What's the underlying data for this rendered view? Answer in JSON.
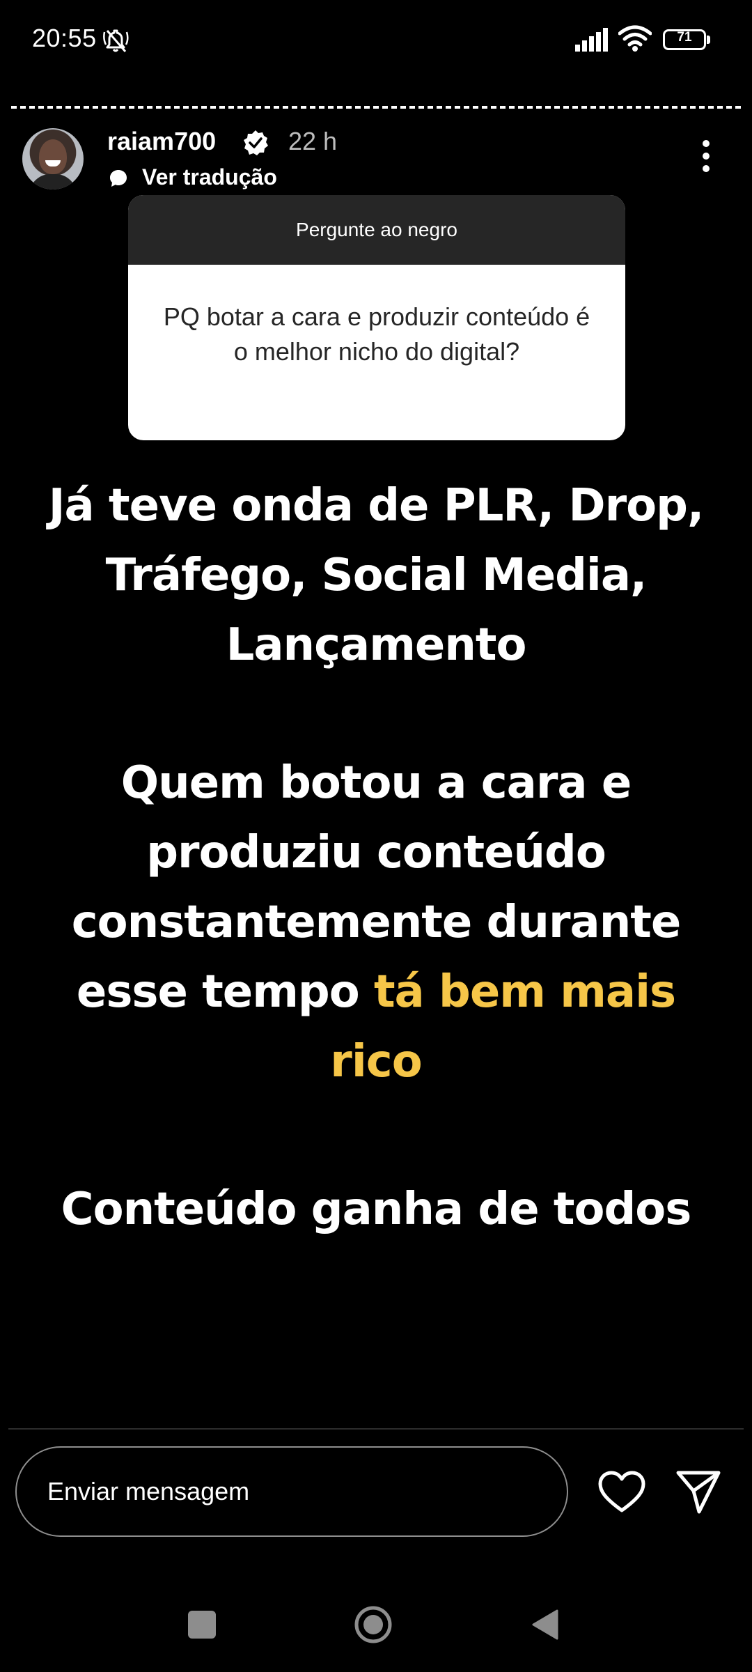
{
  "status_bar": {
    "time": "20:55",
    "battery_level": "71",
    "icons": [
      "mute-icon",
      "signal-icon",
      "wifi-icon",
      "battery-icon"
    ]
  },
  "story": {
    "progress": 1,
    "username": "raiam700",
    "verified": true,
    "time_ago": "22 h",
    "translate_label": "Ver tradução",
    "question_sticker": {
      "header": "Pergunte ao negro",
      "question": "PQ botar a cara e produzir conteúdo é o melhor nicho do digital?"
    },
    "text_block_1": "Já teve onda de PLR, Drop, Tráfego, Social Media, Lançamento",
    "text_block_2_main": "Quem botou a cara e produziu conteúdo constantemente durante esse tempo ",
    "text_block_2_highlight": "tá bem mais rico",
    "text_block_3": "Conteúdo ganha de todos",
    "highlight_color": "#f6c648"
  },
  "footer": {
    "message_placeholder": "Enviar mensagem"
  }
}
